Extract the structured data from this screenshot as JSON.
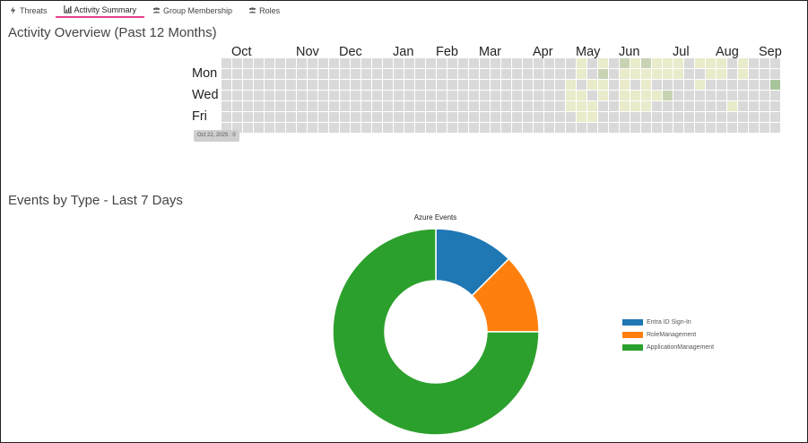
{
  "tabs": [
    {
      "label": "Threats",
      "icon": "bolt-icon",
      "active": false
    },
    {
      "label": "Activity Summary",
      "icon": "bar-chart-icon",
      "active": true
    },
    {
      "label": "Group Membership",
      "icon": "users-icon",
      "active": false
    },
    {
      "label": "Roles",
      "icon": "users-icon",
      "active": false
    }
  ],
  "activity": {
    "title": "Activity Overview (Past 12 Months)",
    "months": [
      "Oct",
      "Nov",
      "Dec",
      "Jan",
      "Feb",
      "Mar",
      "Apr",
      "May",
      "Jun",
      "Jul",
      "Aug",
      "Sep"
    ],
    "day_labels": [
      "Mon",
      "Wed",
      "Fri"
    ],
    "tooltip": "Oct 22, 2025 : 0",
    "colors": {
      "empty": "#d9d9d9",
      "low": "#e9ebca",
      "mid": "#c7d3b3",
      "high": "#a8c49c"
    },
    "chart_data": {
      "type": "heatmap",
      "rows": 7,
      "columns": 52,
      "first_month_column": [
        0,
        6,
        10,
        15,
        19,
        23,
        28,
        32,
        36,
        41,
        45,
        49
      ],
      "active_cells": [
        {
          "col": 32,
          "row": 2,
          "level": 1
        },
        {
          "col": 32,
          "row": 3,
          "level": 1
        },
        {
          "col": 32,
          "row": 4,
          "level": 1
        },
        {
          "col": 33,
          "row": 0,
          "level": 1
        },
        {
          "col": 33,
          "row": 1,
          "level": 1
        },
        {
          "col": 33,
          "row": 3,
          "level": 1
        },
        {
          "col": 33,
          "row": 4,
          "level": 1
        },
        {
          "col": 33,
          "row": 5,
          "level": 1
        },
        {
          "col": 34,
          "row": 2,
          "level": 1
        },
        {
          "col": 34,
          "row": 4,
          "level": 1
        },
        {
          "col": 34,
          "row": 5,
          "level": 1
        },
        {
          "col": 35,
          "row": 0,
          "level": 1
        },
        {
          "col": 35,
          "row": 1,
          "level": 2
        },
        {
          "col": 35,
          "row": 2,
          "level": 1
        },
        {
          "col": 35,
          "row": 3,
          "level": 1
        },
        {
          "col": 37,
          "row": 0,
          "level": 2
        },
        {
          "col": 37,
          "row": 1,
          "level": 1
        },
        {
          "col": 37,
          "row": 2,
          "level": 1
        },
        {
          "col": 37,
          "row": 3,
          "level": 1
        },
        {
          "col": 37,
          "row": 4,
          "level": 1
        },
        {
          "col": 38,
          "row": 0,
          "level": 1
        },
        {
          "col": 38,
          "row": 1,
          "level": 1
        },
        {
          "col": 38,
          "row": 3,
          "level": 1
        },
        {
          "col": 38,
          "row": 4,
          "level": 1
        },
        {
          "col": 39,
          "row": 0,
          "level": 2
        },
        {
          "col": 39,
          "row": 1,
          "level": 1
        },
        {
          "col": 39,
          "row": 2,
          "level": 1
        },
        {
          "col": 39,
          "row": 3,
          "level": 1
        },
        {
          "col": 39,
          "row": 4,
          "level": 1
        },
        {
          "col": 40,
          "row": 0,
          "level": 1
        },
        {
          "col": 40,
          "row": 1,
          "level": 1
        },
        {
          "col": 40,
          "row": 3,
          "level": 1
        },
        {
          "col": 41,
          "row": 0,
          "level": 1
        },
        {
          "col": 41,
          "row": 1,
          "level": 1
        },
        {
          "col": 41,
          "row": 3,
          "level": 2
        },
        {
          "col": 42,
          "row": 0,
          "level": 1
        },
        {
          "col": 42,
          "row": 1,
          "level": 1
        },
        {
          "col": 44,
          "row": 0,
          "level": 1
        },
        {
          "col": 44,
          "row": 2,
          "level": 1
        },
        {
          "col": 45,
          "row": 0,
          "level": 1
        },
        {
          "col": 45,
          "row": 1,
          "level": 1
        },
        {
          "col": 46,
          "row": 0,
          "level": 1
        },
        {
          "col": 46,
          "row": 1,
          "level": 1
        },
        {
          "col": 48,
          "row": 0,
          "level": 1
        },
        {
          "col": 48,
          "row": 1,
          "level": 1
        },
        {
          "col": 47,
          "row": 4,
          "level": 1
        },
        {
          "col": 51,
          "row": 2,
          "level": 3
        }
      ]
    }
  },
  "events": {
    "title": "Events by Type - Last 7 Days",
    "chart_data": {
      "type": "pie",
      "title": "Azure Events",
      "labels": [
        "Entra ID Sign-In",
        "RoleManagement",
        "ApplicationManagement"
      ],
      "values": [
        1,
        1,
        6
      ],
      "colors": [
        "#1f77b4",
        "#ff7f0e",
        "#2ca02c"
      ],
      "legend": "right"
    }
  }
}
